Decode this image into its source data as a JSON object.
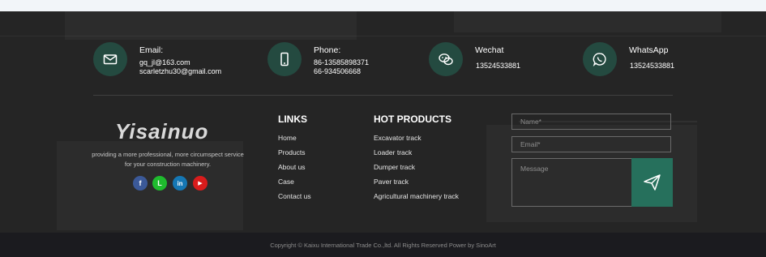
{
  "contacts": [
    {
      "icon": "email-icon",
      "title": "Email:",
      "lines": [
        "gq_jl@163.com",
        "scarletzhu30@gmail.com"
      ]
    },
    {
      "icon": "phone-icon",
      "title": "Phone:",
      "lines": [
        "86-13585898371",
        "66-934506668"
      ]
    },
    {
      "icon": "wechat-icon",
      "title": "Wechat",
      "lines": [
        "13524533881"
      ]
    },
    {
      "icon": "whatsapp-icon",
      "title": "WhatsApp",
      "lines": [
        "13524533881"
      ]
    }
  ],
  "brand": {
    "logo_text": "Yisainuo",
    "tagline": "providing a more professional, more circumspect service for your construction machinery."
  },
  "social": [
    {
      "icon": "facebook-icon",
      "glyph": "f",
      "color": "#3b5998"
    },
    {
      "icon": "line-icon",
      "glyph": "L",
      "color": "#1fbb2e"
    },
    {
      "icon": "linkedin-icon",
      "glyph": "in",
      "color": "#1577b4"
    },
    {
      "icon": "youtube-icon",
      "glyph": "▶",
      "color": "#d81c1c"
    }
  ],
  "links": {
    "heading": "LINKS",
    "items": [
      "Home",
      "Products",
      "About us",
      "Case",
      "Contact us"
    ]
  },
  "hot_products": {
    "heading": "HOT PRODUCTS",
    "items": [
      "Excavator track",
      "Loader track",
      "Dumper track",
      "Paver track",
      "Agricultural machinery track"
    ]
  },
  "form": {
    "name_placeholder": "Name*",
    "email_placeholder": "Email*",
    "message_placeholder": "Message",
    "send_icon": "paper-plane-icon",
    "accent_color": "#26705c"
  },
  "copyright": "Copyright © Kaixu International Trade Co.,ltd. All Rights Reserved  Power by SinoArt"
}
